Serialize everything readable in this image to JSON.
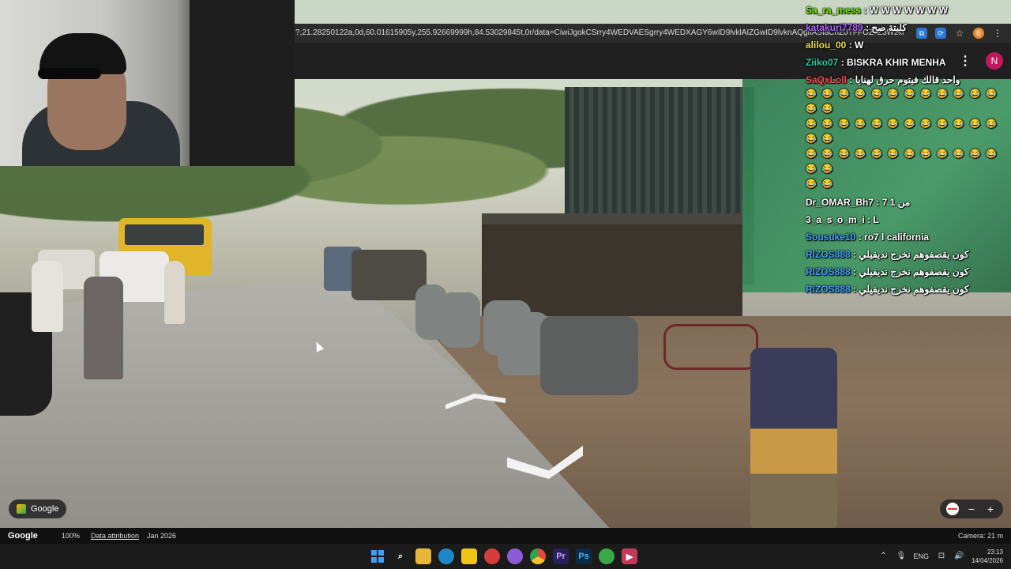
{
  "browser": {
    "url": "?,21.28250122a,0d,60.01615905y,255.92669999h,84.53029845t,0r/data=CiwiJgokCSrry4WEDVAESgrry4WEDXAGY6wID9lvklAIZGwID9lvknAQglIASIaChZ0TFFOZkZ3WzkNNF3NTFfdEl3dSWE",
    "icons": [
      "cast-icon",
      "extension-icon",
      "star-icon",
      "profile-icon",
      "menu-icon"
    ]
  },
  "chat": {
    "messages": [
      {
        "user": "Sa_ra_mess",
        "user_color": "#7cfc00",
        "text": "W W W W W W W"
      },
      {
        "user": "katakuri7789",
        "user_color": "#b066ff",
        "text": "كلبتة صح"
      },
      {
        "user": "alilou_00",
        "user_color": "#f0e040",
        "text": "W"
      },
      {
        "user": "Ziiko07",
        "user_color": "#22d3a6",
        "text": "BISKRA KHIR MENHA"
      },
      {
        "user": "SaQxLoll",
        "user_color": "#ff4d4d",
        "text": "واحد قالك فيتوم حرق لهنايا"
      },
      {
        "user": "Dr_OMAR_Bh7",
        "user_color": "#ffffff",
        "text": "من 1 7"
      },
      {
        "user": "3_a_s_o_m_i",
        "user_color": "#ffffff",
        "text": "L"
      },
      {
        "user": "Sousuke10",
        "user_color": "#3ea6ff",
        "text": "ro7 l california"
      },
      {
        "user": "RIZOS888",
        "user_color": "#3ea6ff",
        "text": "كون يقصفوهم نخرج نديفيلي"
      },
      {
        "user": "RIZOS888",
        "user_color": "#3ea6ff",
        "text": "كون يقصفوهم نخرج نديفيلي"
      },
      {
        "user": "RIZOS888",
        "user_color": "#3ea6ff",
        "text": "كون يقصفوهم نخرج نديفيلي"
      }
    ],
    "emoji_line": "😂 😂 😂 😂 😂 😂 😂 😂 😂 😂 😂 😂 😂 😂"
  },
  "streetview": {
    "badge_label": "Google",
    "footer": {
      "logo": "Google",
      "zoom": "100%",
      "attribution": "Data attribution",
      "date": "Jan 2026",
      "camera": "Camera: 21 m"
    },
    "controls": {
      "zoom_out": "−",
      "zoom_in": "+"
    },
    "account_initial": "N"
  },
  "taskbar": {
    "apps": [
      {
        "name": "start",
        "icon": "windows-icon",
        "color": "#1e90ff"
      },
      {
        "name": "search",
        "icon": "search-icon",
        "color": "#1b1b1b"
      },
      {
        "name": "explorer",
        "icon": "folder-icon",
        "color": "#e8b73a"
      },
      {
        "name": "edge",
        "icon": "edge-icon",
        "color": "#1e88c7"
      },
      {
        "name": "store",
        "icon": "store-icon",
        "color": "#f0c419"
      },
      {
        "name": "app1",
        "icon": "app-icon",
        "color": "#d43d3d"
      },
      {
        "name": "app2",
        "icon": "app-icon",
        "color": "#8e5bd8"
      },
      {
        "name": "chrome",
        "icon": "chrome-icon",
        "color": "#e04b3a"
      },
      {
        "name": "premiere",
        "icon": "premiere-icon",
        "color": "#2a1f5a",
        "label": "Pr"
      },
      {
        "name": "photoshop",
        "icon": "photoshop-icon",
        "color": "#0a2a45",
        "label": "Ps"
      },
      {
        "name": "app3",
        "icon": "app-icon",
        "color": "#3aa84a"
      },
      {
        "name": "streaming",
        "icon": "play-icon",
        "color": "#c23a5a"
      }
    ],
    "lang": "ENG",
    "time": "23:13",
    "date": "14/04/2026"
  }
}
